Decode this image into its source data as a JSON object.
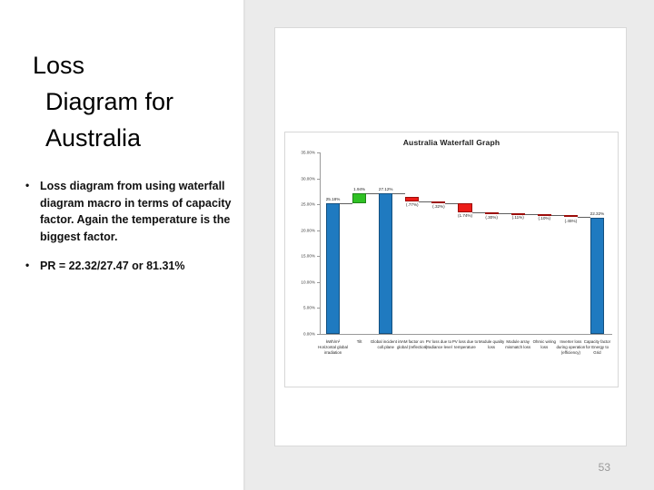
{
  "slide": {
    "title_lines": [
      "Loss",
      "Diagram for",
      "Australia"
    ],
    "page_number": "53",
    "bullets": [
      "Loss diagram from using waterfall diagram macro in terms of capacity factor. Again the temperature is the biggest factor.",
      "PR = 22.32/27.47 or 81.31%"
    ]
  },
  "colors": {
    "bar_blue": "#1f7ac0",
    "bar_green": "#2fc124",
    "bar_red": "#ec1c18",
    "panel_grey": "#ebebeb",
    "page_number_grey": "#9a9a9a"
  },
  "chart_data": {
    "type": "bar",
    "subtype": "waterfall",
    "title": "Australia Waterfall Graph",
    "xlabel": "",
    "ylabel": "",
    "ylim": [
      0,
      35
    ],
    "yticks": [
      "0.00%",
      "5.00%",
      "10.00%",
      "15.00%",
      "20.00%",
      "25.00%",
      "30.00%",
      "35.00%"
    ],
    "ytick_values": [
      0,
      5,
      10,
      15,
      20,
      25,
      30,
      35
    ],
    "grid": false,
    "legend": "none",
    "categories": [
      "kWh/m² Horizontal global irradiation",
      "Tilt",
      "Global incident in coll.plane",
      "IAM factor on global (reflection)",
      "PV loss due to irradiance level",
      "PV loss due to temperature",
      "Module quality loss",
      "Module array mismatch loss",
      "Ohmic wiring loss",
      "Inverter loss during operation (efficiency)",
      "Capacity factor for Energy to Grid"
    ],
    "labels": [
      "25.18%",
      "1.94%",
      "27.12%",
      "(.77%)",
      "(.32%)",
      "(1.74%)",
      "(.30%)",
      "(.11%)",
      "(.10%)",
      "(.45%)",
      "22.32%"
    ],
    "bar_kind": [
      "total",
      "increase",
      "total",
      "decrease",
      "decrease",
      "decrease",
      "decrease",
      "decrease",
      "decrease",
      "decrease",
      "total"
    ],
    "deltas": [
      25.18,
      1.94,
      27.12,
      -0.77,
      -0.32,
      -1.74,
      -0.3,
      -0.11,
      -0.1,
      -0.45,
      22.32
    ],
    "cumulative_start": [
      0,
      25.18,
      0,
      26.35,
      25.58,
      25.26,
      23.52,
      23.22,
      23.11,
      23.01,
      0
    ],
    "cumulative_end": [
      25.18,
      27.12,
      27.12,
      27.12,
      25.9,
      27.0,
      23.82,
      23.33,
      23.21,
      23.46,
      22.32
    ],
    "bar_colors": [
      "#1f7ac0",
      "#2fc124",
      "#1f7ac0",
      "#ec1c18",
      "#ec1c18",
      "#ec1c18",
      "#ec1c18",
      "#ec1c18",
      "#ec1c18",
      "#ec1c18",
      "#1f7ac0"
    ]
  }
}
